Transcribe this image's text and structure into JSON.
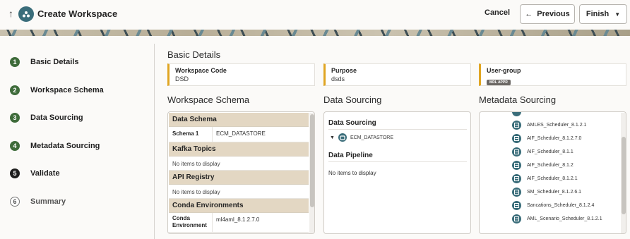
{
  "header": {
    "title": "Create Workspace",
    "cancel_label": "Cancel",
    "previous_label": "Previous",
    "finish_label": "Finish"
  },
  "steps": [
    {
      "number": "1",
      "label": "Basic Details",
      "state": "done"
    },
    {
      "number": "2",
      "label": "Workspace Schema",
      "state": "done"
    },
    {
      "number": "3",
      "label": "Data Sourcing",
      "state": "done"
    },
    {
      "number": "4",
      "label": "Metadata Sourcing",
      "state": "done"
    },
    {
      "number": "5",
      "label": "Validate",
      "state": "current"
    },
    {
      "number": "6",
      "label": "Summary",
      "state": "todo"
    }
  ],
  "basic_details": {
    "title": "Basic Details",
    "workspace_code_label": "Workspace Code",
    "workspace_code_value": "DSD",
    "purpose_label": "Purpose",
    "purpose_value": "dsds",
    "user_group_label": "User-group",
    "user_group_value": "MDL APPR"
  },
  "workspace_schema": {
    "title": "Workspace Schema",
    "data_schema_header": "Data Schema",
    "schema1_key": "Schema 1",
    "schema1_value": "ECM_DATASTORE",
    "kafka_header": "Kafka Topics",
    "kafka_empty": "No items to display",
    "api_header": "API Registry",
    "api_empty": "No items to display",
    "conda_header": "Conda Environments",
    "conda_key": "Conda Environment",
    "conda_value": "ml4aml_8.1.2.7.0"
  },
  "data_sourcing": {
    "title": "Data Sourcing",
    "inner_title": "Data Sourcing",
    "node_label": "ECM_DATASTORE",
    "pipeline_title": "Data Pipeline",
    "pipeline_empty": "No items to display"
  },
  "metadata_sourcing": {
    "title": "Metadata Sourcing",
    "items": [
      "AMLES_Scheduler_8.1.2.1",
      "AIF_Scheduler_8.1.2.7.0",
      "AIF_Scheduler_8.1.1",
      "AIF_Scheduler_8.1.2",
      "AIF_Scheduler_8.1.2.1",
      "SM_Scheduler_8.1.2.6.1",
      "Sancations_Scheduler_8.1.2.4",
      "AML_Scenario_Scheduler_8.1.2.1"
    ]
  },
  "colors": {
    "accent_teal": "#3a6d7a",
    "step_done": "#3e6b3a",
    "card_accent": "#e0a522",
    "group_header_bg": "#e3d7c3"
  }
}
